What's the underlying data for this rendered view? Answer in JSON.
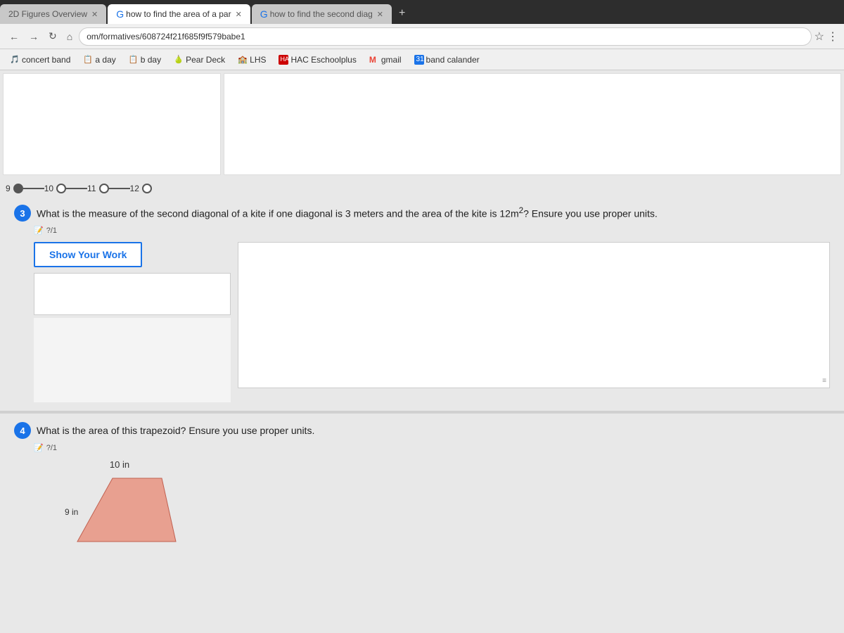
{
  "browser": {
    "tabs": [
      {
        "id": "tab1",
        "label": "2D Figures Overview",
        "active": false
      },
      {
        "id": "tab2",
        "label": "how to find the area of a par",
        "active": true
      },
      {
        "id": "tab3",
        "label": "how to find the second diag",
        "active": false
      }
    ],
    "address": "om/formatives/608724f21f685f9f579babe1",
    "new_tab_label": "+"
  },
  "bookmarks": [
    {
      "id": "concert-band",
      "label": "concert band",
      "icon": "🎵"
    },
    {
      "id": "a-day",
      "label": "a day",
      "icon": "📋"
    },
    {
      "id": "b-day",
      "label": "b day",
      "icon": "📋"
    },
    {
      "id": "pear-deck",
      "label": "Pear Deck",
      "icon": "🍐"
    },
    {
      "id": "lhs",
      "label": "LHS",
      "icon": "🏫"
    },
    {
      "id": "hac",
      "label": "HAC Eschoolplus",
      "icon": "🏫"
    },
    {
      "id": "gmail",
      "label": "gmail",
      "icon": "M"
    },
    {
      "id": "band-cal",
      "label": "band calander",
      "icon": "31"
    }
  ],
  "page_nav": {
    "pages": [
      {
        "num": "9",
        "state": "visited"
      },
      {
        "num": "10",
        "state": "active"
      },
      {
        "num": "11",
        "state": "active"
      },
      {
        "num": "12",
        "state": "active"
      }
    ]
  },
  "questions": {
    "q3": {
      "number": "3",
      "text": "What is the measure of the second diagonal of a kite if one diagonal is 3 meters and the area of the kite is 12m",
      "superscript": "2",
      "suffix": "? Ensure you use proper units.",
      "points": "?/1",
      "show_work_label": "Show Your Work"
    },
    "q4": {
      "number": "4",
      "text": "What is the area of this trapezoid? Ensure you use proper units.",
      "points": "?/1",
      "dimension_top": "10 in",
      "dimension_side": "9 in"
    }
  },
  "icons": {
    "back": "←",
    "forward": "→",
    "refresh": "↻",
    "home": "⌂",
    "star": "☆",
    "menu": "⋮",
    "search": "🔍",
    "drag": "⠿"
  }
}
